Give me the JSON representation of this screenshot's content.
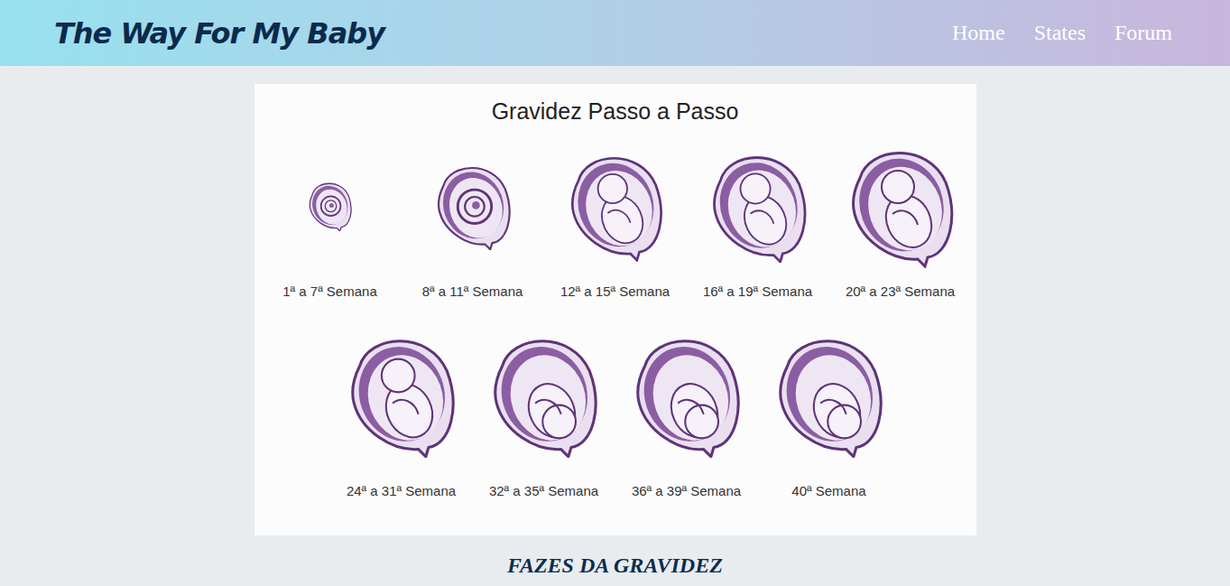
{
  "header": {
    "logo": "The Way For My Baby",
    "nav": [
      {
        "label": "Home"
      },
      {
        "label": "States"
      },
      {
        "label": "Forum"
      }
    ]
  },
  "infographic": {
    "title": "Gravidez Passo a Passo",
    "rows": [
      [
        {
          "label": "1ª a 7ª Semana"
        },
        {
          "label": "8ª a 11ª Semana"
        },
        {
          "label": "12ª a 15ª Semana"
        },
        {
          "label": "16ª a 19ª Semana"
        },
        {
          "label": "20ª a 23ª Semana"
        }
      ],
      [
        {
          "label": "24ª a 31ª Semana"
        },
        {
          "label": "32ª a 35ª Semana"
        },
        {
          "label": "36ª a 39ª Semana"
        },
        {
          "label": "40ª Semana"
        }
      ]
    ]
  },
  "caption": "FAZES DA GRAVIDEZ"
}
